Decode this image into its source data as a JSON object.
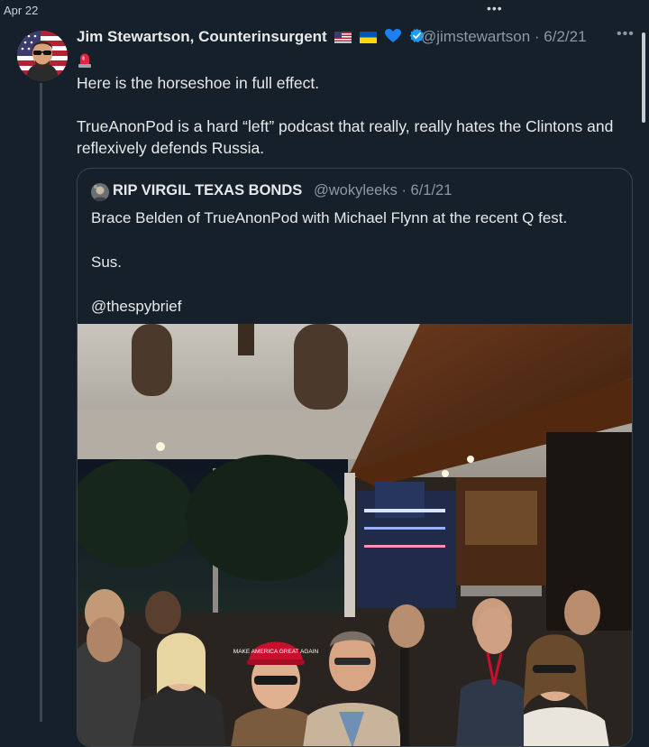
{
  "timeline": {
    "date": "Apr 22"
  },
  "tweet": {
    "author_name": "Jim Stewartson, Counterinsurgent",
    "handle_time": "@jimstewartson · 6/2/21",
    "flags": [
      "us-flag-icon",
      "ukraine-flag-icon",
      "blue-heart-icon",
      "verified-badge-icon",
      "siren-icon"
    ],
    "text": "Here is the horseshoe in full effect.\n\nTrueAnonPod is a hard “left” podcast that really, really hates the Clintons and reflexively defends Russia."
  },
  "quoted_tweet": {
    "author_name": "RIP VIRGIL TEXAS BONDS",
    "handle_time": "@wokyleeks · 6/1/21",
    "text": "Brace Belden of TrueAnonPod with Michael Flynn at the recent Q fest.\n\nSus.\n\n@thespybrief",
    "hat_text": "MAKE AMERICA GREAT AGAIN"
  },
  "colors": {
    "background": "#15202b",
    "text_primary": "#e7e9ea",
    "text_secondary": "#8b98a5",
    "border": "#38444d",
    "verified": "#1d9bf0",
    "hat_red": "#c8102e"
  }
}
